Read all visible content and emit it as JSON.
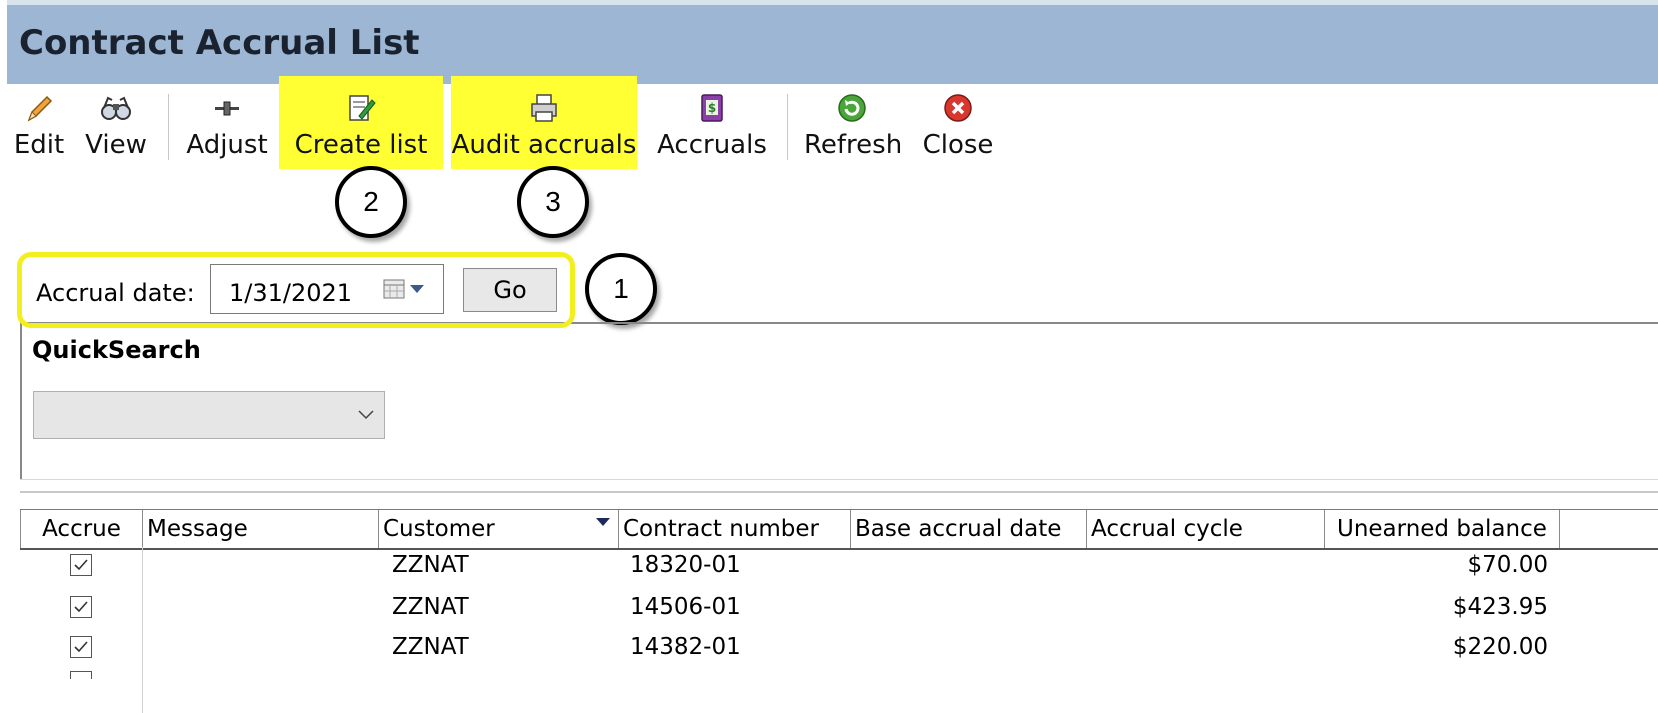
{
  "window": {
    "title": "Contract Accrual List"
  },
  "toolbar": {
    "edit": "Edit",
    "view": "View",
    "adjust": "Adjust",
    "create_list": "Create list",
    "audit_accruals": "Audit accruals",
    "accruals": "Accruals",
    "refresh": "Refresh",
    "close": "Close"
  },
  "callouts": {
    "one": "1",
    "two": "2",
    "three": "3"
  },
  "filter": {
    "label": "Accrual date:",
    "date_value": "1/31/2021",
    "go_label": "Go"
  },
  "quicksearch": {
    "label": "QuickSearch",
    "selected": ""
  },
  "grid": {
    "columns": [
      "Accrue",
      "Message",
      "Customer",
      "Contract number",
      "Base accrual date",
      "Accrual cycle",
      "Unearned balance"
    ],
    "rows": [
      {
        "accrue": true,
        "message": "",
        "customer": "ZZNAT",
        "contract": "18320-01",
        "base_date": "",
        "cycle": "",
        "balance": "$70.00"
      },
      {
        "accrue": true,
        "message": "",
        "customer": "ZZNAT",
        "contract": "14506-01",
        "base_date": "",
        "cycle": "",
        "balance": "$423.95"
      },
      {
        "accrue": true,
        "message": "",
        "customer": "ZZNAT",
        "contract": "14382-01",
        "base_date": "",
        "cycle": "",
        "balance": "$220.00"
      }
    ]
  },
  "colors": {
    "titlebar": "#9cb6d3",
    "highlight": "#ffff33",
    "callout_panel": "#f2ef1f"
  },
  "icons": [
    "pencil-icon",
    "binoculars-icon",
    "adjust-icon",
    "create-list-icon",
    "printer-icon",
    "accruals-icon",
    "refresh-icon",
    "close-icon",
    "calendar-icon",
    "chevron-down-icon",
    "checkbox-checked-icon"
  ]
}
